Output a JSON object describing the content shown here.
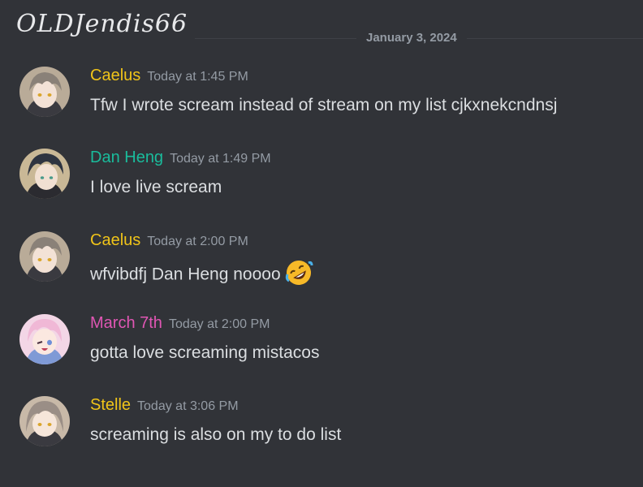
{
  "watermark": "OLDJendis66",
  "date_divider": "January 3, 2024",
  "colors": {
    "background": "#313338",
    "caelus": "#f0c419",
    "dan_heng": "#1abc9c",
    "march_7th": "#e056b4",
    "stelle": "#f0c419"
  },
  "messages": [
    {
      "username": "Caelus",
      "timestamp": "Today at 1:45 PM",
      "content": "Tfw I wrote scream instead of stream on my list cjkxnekcndnsj"
    },
    {
      "username": "Dan Heng",
      "timestamp": "Today at 1:49 PM",
      "content": "I love live scream"
    },
    {
      "username": "Caelus",
      "timestamp": "Today at 2:00 PM",
      "content": "wfvibdfj Dan Heng noooo",
      "emoji": "rolling-on-floor-laughing"
    },
    {
      "username": "March 7th",
      "timestamp": "Today at 2:00 PM",
      "content": "gotta love screaming mistacos"
    },
    {
      "username": "Stelle",
      "timestamp": "Today at 3:06 PM",
      "content": "screaming is also on my to do list"
    }
  ]
}
